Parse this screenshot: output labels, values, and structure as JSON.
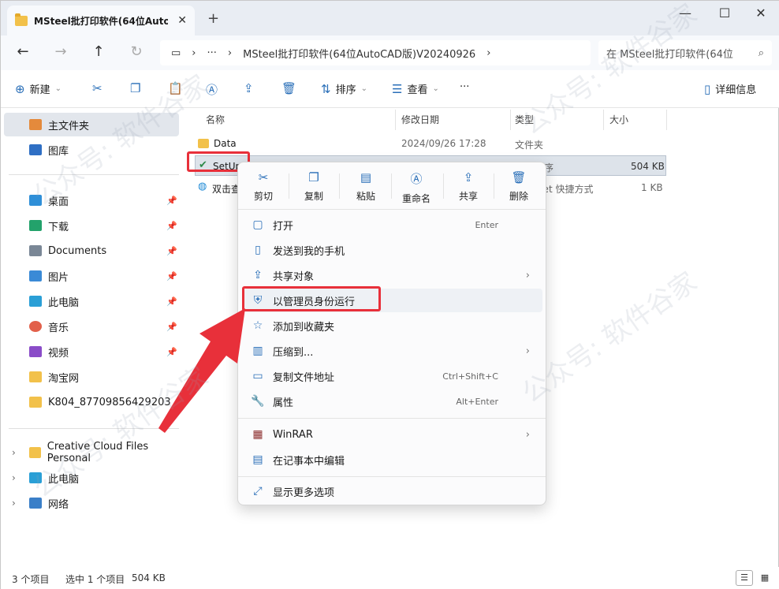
{
  "tab": {
    "title": "MSteel批打印软件(64位AutoC",
    "close": "✕",
    "new_tab": "+"
  },
  "window_controls": {
    "minimize": "—",
    "maximize": "☐",
    "close": "✕"
  },
  "address": {
    "segments": [
      "›",
      "···",
      "›",
      "MSteel批打印软件(64位AutoCAD版)V20240926",
      "›"
    ],
    "search_placeholder": "在 MSteel批打印软件(64位"
  },
  "command_bar": {
    "new_label": "新建",
    "sort_label": "排序",
    "view_label": "查看",
    "more_label": "···",
    "details_label": "详细信息"
  },
  "sidebar": {
    "items": [
      {
        "label": "主文件夹",
        "icon": "home-icon"
      },
      {
        "label": "图库",
        "icon": "gallery-icon"
      },
      {
        "label": "桌面",
        "icon": "desktop-icon",
        "pinned": true
      },
      {
        "label": "下载",
        "icon": "download-icon",
        "pinned": true
      },
      {
        "label": "Documents",
        "icon": "document-icon",
        "pinned": true
      },
      {
        "label": "图片",
        "icon": "pictures-icon",
        "pinned": true
      },
      {
        "label": "此电脑",
        "icon": "pc-icon",
        "pinned": true
      },
      {
        "label": "音乐",
        "icon": "music-icon",
        "pinned": true
      },
      {
        "label": "视频",
        "icon": "video-icon",
        "pinned": true
      },
      {
        "label": "淘宝网",
        "icon": "folder-icon"
      },
      {
        "label": "K804_87709856429203",
        "icon": "folder-icon"
      }
    ],
    "tree": [
      {
        "label": "Creative Cloud Files Personal",
        "icon": "folder-icon"
      },
      {
        "label": "此电脑",
        "icon": "pc-icon"
      },
      {
        "label": "网络",
        "icon": "network-icon"
      }
    ]
  },
  "columns": {
    "name": "名称",
    "date": "修改日期",
    "type": "类型",
    "size": "大小"
  },
  "files": [
    {
      "name": "Data",
      "date": "2024/09/26 17:28",
      "type": "文件夹",
      "size": ""
    },
    {
      "name": "SetUp",
      "date": "",
      "type": "应用程序",
      "size": "504 KB"
    },
    {
      "name": "双击查",
      "date": "",
      "type": "Internet 快捷方式",
      "size": "1 KB"
    }
  ],
  "context_menu": {
    "quick_actions": [
      "剪切",
      "复制",
      "粘贴",
      "重命名",
      "共享",
      "删除"
    ],
    "items": [
      {
        "label": "打开",
        "accel": "Enter"
      },
      {
        "label": "发送到我的手机",
        "accel": ""
      },
      {
        "label": "共享对象",
        "accel": "",
        "submenu": "›"
      },
      {
        "label": "以管理员身份运行",
        "accel": ""
      },
      {
        "label": "添加到收藏夹",
        "accel": ""
      },
      {
        "label": "压缩到...",
        "accel": "",
        "submenu": "›"
      },
      {
        "label": "复制文件地址",
        "accel": "Ctrl+Shift+C"
      },
      {
        "label": "属性",
        "accel": "Alt+Enter"
      },
      {
        "label": "WinRAR",
        "accel": "",
        "submenu": "›"
      },
      {
        "label": "在记事本中编辑",
        "accel": ""
      },
      {
        "label": "显示更多选项",
        "accel": ""
      }
    ]
  },
  "status": {
    "count": "3 个项目",
    "selected": "选中 1 个项目",
    "size": "504 KB"
  },
  "watermark": "公众号: 软件谷家",
  "colors": {
    "highlight_red": "#e8303a",
    "accent_blue": "#2a6fb8",
    "folder_yellow": "#f2c14a"
  }
}
